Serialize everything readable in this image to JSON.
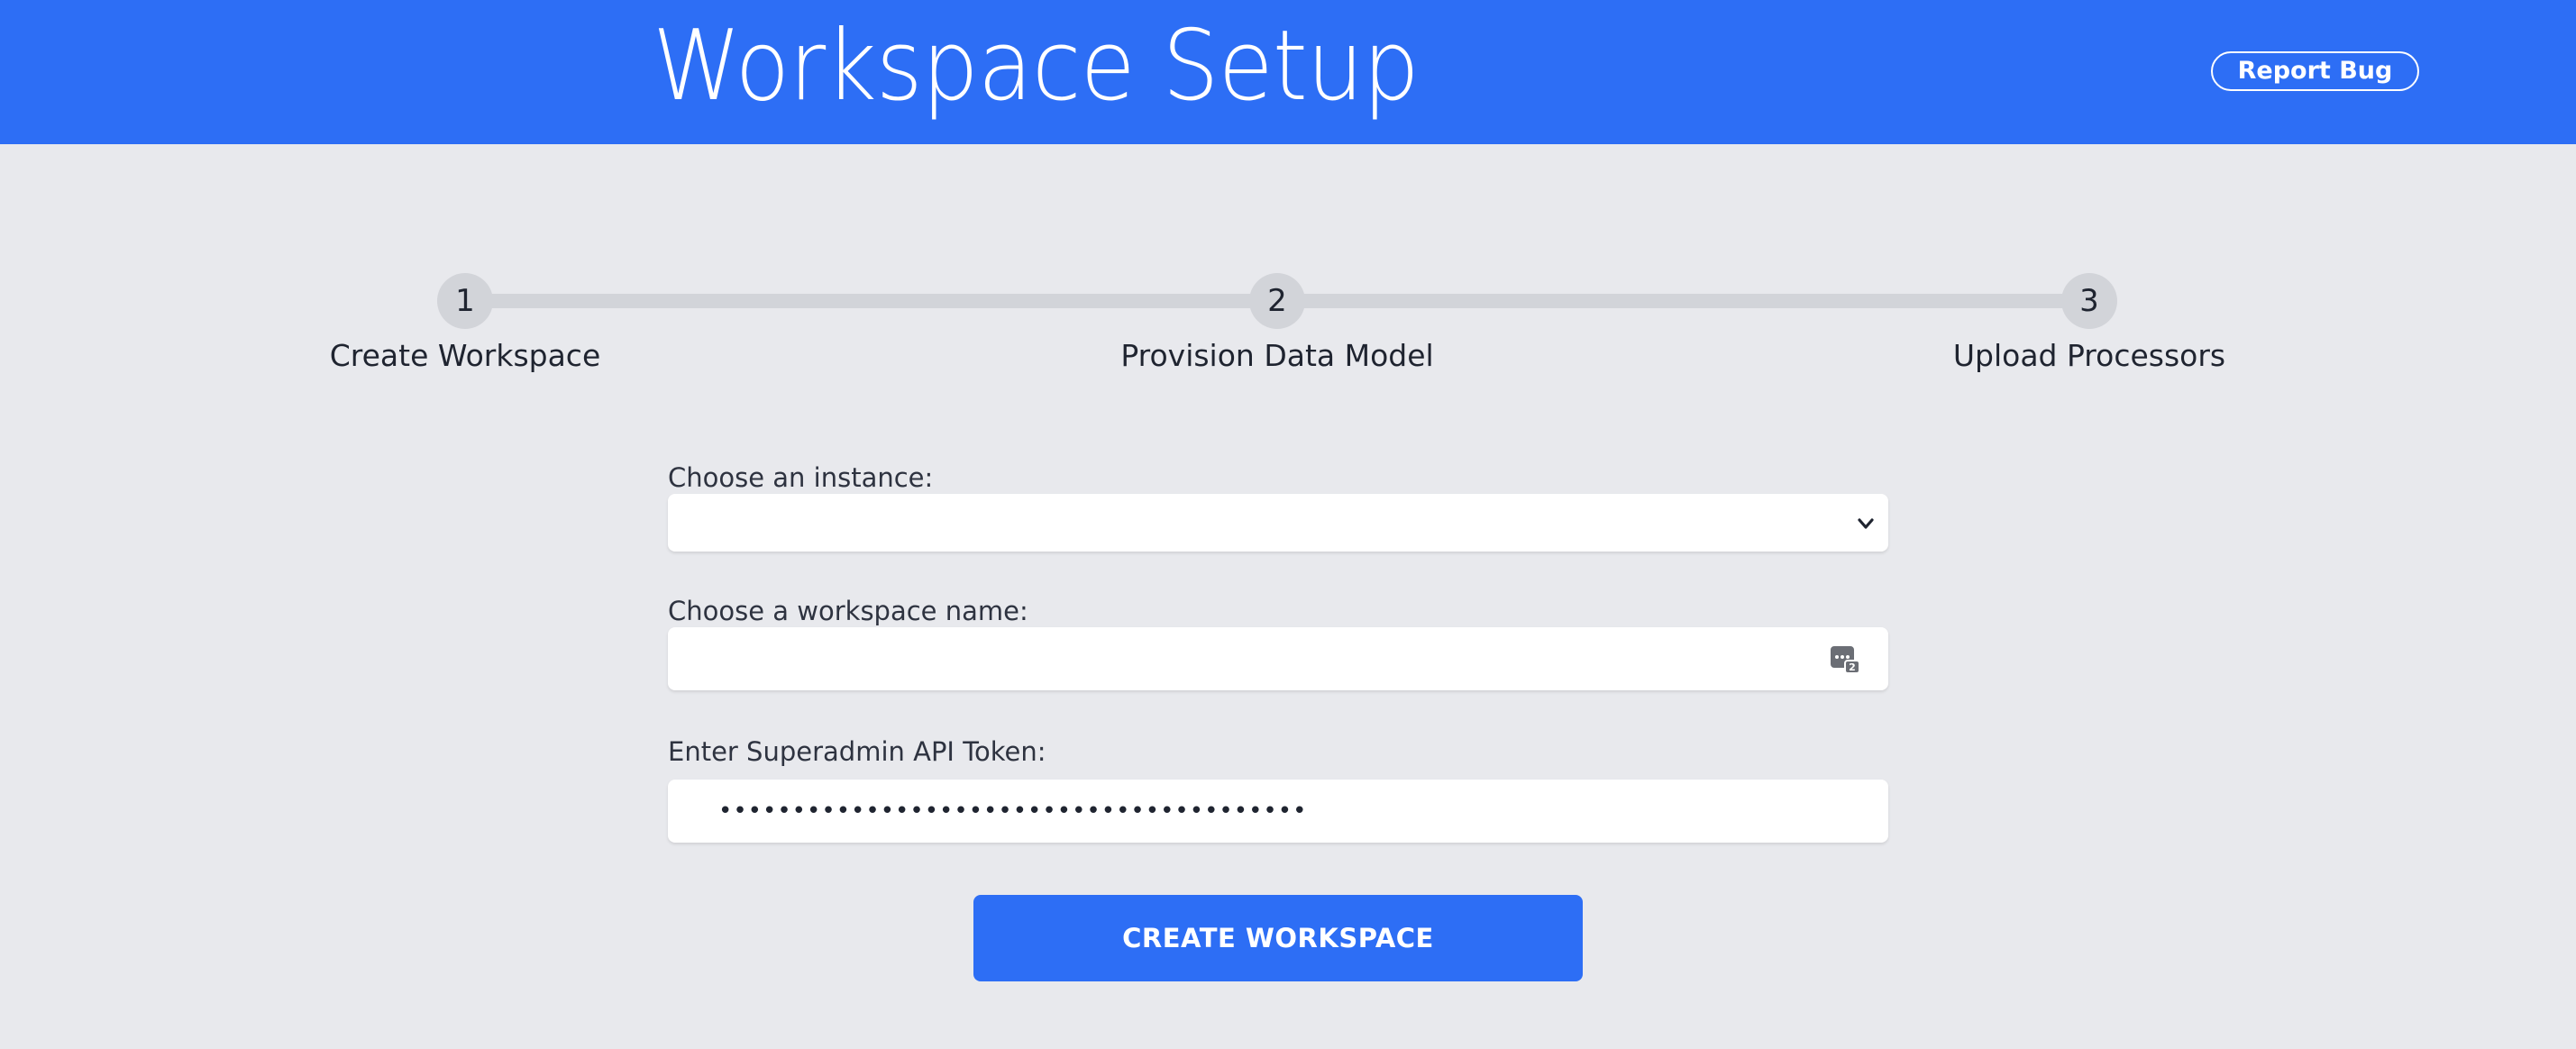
{
  "header": {
    "title": "Workspace Setup",
    "report_bug_label": "Report Bug"
  },
  "stepper": {
    "steps": [
      {
        "number": "1",
        "label": "Create Workspace"
      },
      {
        "number": "2",
        "label": "Provision Data Model"
      },
      {
        "number": "3",
        "label": "Upload Processors"
      }
    ]
  },
  "form": {
    "instance": {
      "label": "Choose an instance:",
      "value": ""
    },
    "workspace_name": {
      "label": "Choose a workspace name:",
      "value": ""
    },
    "api_token": {
      "label": "Enter Superadmin API Token:",
      "value": "••••••••••••••••••••••••••••••••••••••••"
    },
    "submit_label": "CREATE WORKSPACE"
  },
  "colors": {
    "brand_blue": "#2d6ef5",
    "page_background": "#e8e9ed",
    "stepper_gray": "#d2d4d9"
  },
  "icons": {
    "select_chevron": "chevron-down-icon",
    "password_manager": "password-manager-icon"
  }
}
